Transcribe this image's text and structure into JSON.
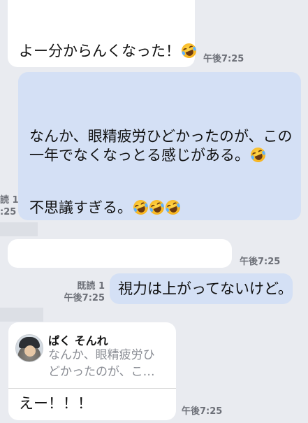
{
  "messages": [
    {
      "text": "よー分からんくなった！",
      "time": "午後7:25"
    },
    {
      "line1": "なんか、眼精疲労ひどかったのが、この",
      "line2": "一年でなくなっとる感じがある。",
      "line3": "不思議すぎる。"
    },
    {
      "time": "午後7:25"
    },
    {
      "text": "視力は上がってないけど。",
      "read": "既読 1",
      "time": "午後7:25"
    },
    {
      "quote_name": "ぱく そんれ",
      "quote_line1": "なんか、眼精疲労ひ",
      "quote_line2": "どかったのが、こ…",
      "text": "えー！！！",
      "time": "午後7:25"
    }
  ],
  "edge_labels": {
    "read": "読 1",
    "time": ":25"
  },
  "icons": {
    "emoji": "rolling-laugh-emoji-icon",
    "avatar": "avatar"
  },
  "colors": {
    "background": "#e9ebf0",
    "incoming": "#ffffff",
    "outgoing": "#d4e0f5",
    "meta": "#6d7078"
  }
}
